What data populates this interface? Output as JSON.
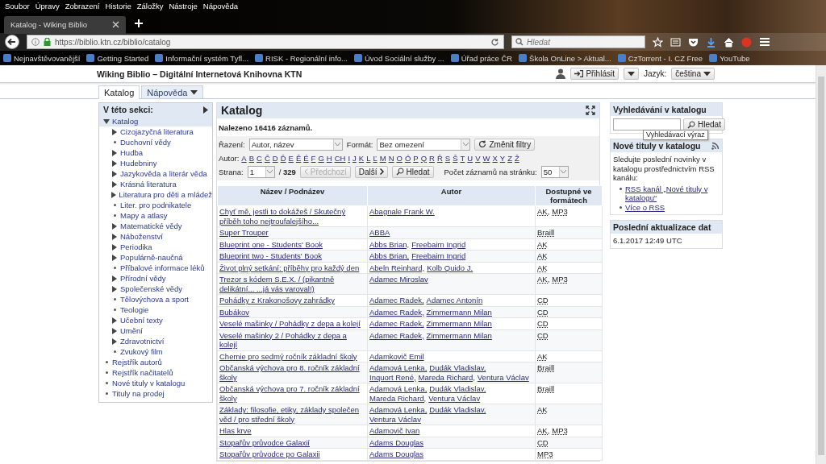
{
  "browser": {
    "menu": [
      "Soubor",
      "Úpravy",
      "Zobrazení",
      "Historie",
      "Záložky",
      "Nástroje",
      "Nápověda"
    ],
    "tab_title": "Katalog - Wiking Biblio",
    "url": "https://biblio.ktn.cz/biblio/catalog",
    "search": {
      "placeholder": "Hledat"
    },
    "bookmarks": [
      "Nejnavštěvovanější",
      "Getting Started",
      "Informační systém Tyfl...",
      "RISK - Regionální info...",
      "Úvod Sociální služby ...",
      "Úřad práce ČR",
      "Škola OnLine > Aktual...",
      "CzTorrent - I. CZ Free",
      "YouTube"
    ]
  },
  "site": {
    "title": "Wiking Biblio – Digitální Internetová Knihovna KTN",
    "login": "Přihlásit",
    "language_label": "Jazyk:",
    "language": "čeština",
    "tabs": [
      {
        "label": "Katalog",
        "selected": true,
        "dropdown": false
      },
      {
        "label": "Nápověda",
        "selected": false,
        "dropdown": true
      }
    ]
  },
  "sidebar": {
    "title": "V této sekci:",
    "items": [
      {
        "label": "Katalog",
        "kind": "branch",
        "expanded": true,
        "selected": true,
        "children": [
          {
            "label": "Cizojazyčná literatura",
            "kind": "branch",
            "expanded": false,
            "selected": false
          },
          {
            "label": "Duchovní vědy",
            "kind": "leaf",
            "selected": false
          },
          {
            "label": "Hudba",
            "kind": "branch",
            "expanded": false,
            "selected": false
          },
          {
            "label": "Hudebniny",
            "kind": "branch",
            "expanded": false,
            "selected": false
          },
          {
            "label": "Jazykověda a literár věda",
            "kind": "branch",
            "expanded": false,
            "selected": false
          },
          {
            "label": "Krásná literatura",
            "kind": "branch",
            "expanded": false,
            "selected": false
          },
          {
            "label": "Literatura pro děti a mládež",
            "kind": "branch",
            "expanded": false,
            "selected": false
          },
          {
            "label": "Liter. pro podnikatele",
            "kind": "leaf",
            "selected": false
          },
          {
            "label": "Mapy a atlasy",
            "kind": "leaf",
            "selected": false
          },
          {
            "label": "Matematické vědy",
            "kind": "branch",
            "expanded": false,
            "selected": false
          },
          {
            "label": "Náboženství",
            "kind": "branch",
            "expanded": false,
            "selected": false
          },
          {
            "label": "Periodika",
            "kind": "branch",
            "expanded": false,
            "selected": false
          },
          {
            "label": "Populárně-naučná",
            "kind": "branch",
            "expanded": false,
            "selected": false
          },
          {
            "label": "Příbalové informace léků",
            "kind": "leaf",
            "selected": false
          },
          {
            "label": "Přírodní vědy",
            "kind": "branch",
            "expanded": false,
            "selected": false
          },
          {
            "label": "Společenské vědy",
            "kind": "branch",
            "expanded": false,
            "selected": false
          },
          {
            "label": "Tělovýchova a sport",
            "kind": "leaf",
            "selected": false
          },
          {
            "label": "Teologie",
            "kind": "leaf",
            "selected": false
          },
          {
            "label": "Učební texty",
            "kind": "branch",
            "expanded": false,
            "selected": false
          },
          {
            "label": "Umění",
            "kind": "branch",
            "expanded": false,
            "selected": false
          },
          {
            "label": "Zdravotnictví",
            "kind": "branch",
            "expanded": false,
            "selected": false
          },
          {
            "label": "Zvukový film",
            "kind": "leaf",
            "selected": false
          }
        ]
      },
      {
        "label": "Rejstřík autorů",
        "kind": "leaf",
        "selected": false
      },
      {
        "label": "Rejstřík načitatelů",
        "kind": "leaf",
        "selected": false
      },
      {
        "label": "Nové tituly v katalogu",
        "kind": "leaf",
        "selected": false
      },
      {
        "label": "Tituly na prodej",
        "kind": "leaf",
        "selected": false
      }
    ]
  },
  "main": {
    "heading": "Katalog",
    "found": "Nalezeno 16416 záznamů.",
    "sort_label": "Řazení:",
    "sort_value": "Autor, název",
    "format_label": "Formát:",
    "format_value": "Bez omezení",
    "change_filters": "Změnit filtry",
    "author_label": "Autor:",
    "letters": [
      "A",
      "B",
      "C",
      "Č",
      "D",
      "Ď",
      "E",
      "Ě",
      "É",
      "F",
      "G",
      "H",
      "CH",
      "I",
      "J",
      "K",
      "L",
      "Ľ",
      "M",
      "N",
      "O",
      "Ó",
      "P",
      "Q",
      "R",
      "Ř",
      "S",
      "Š",
      "T",
      "U",
      "V",
      "W",
      "X",
      "Y",
      "Z",
      "Ž"
    ],
    "page_label": "Strana:",
    "page_value": "1",
    "page_total": "/ **329**",
    "prev": {
      "label": "Předchozí",
      "disabled": true
    },
    "next": {
      "label": "Další",
      "disabled": false
    },
    "search_button": "Hledat",
    "per_page_label": "Počet záznamů na stránku:",
    "per_page_value": "50",
    "table": {
      "columns": [
        "Název / Podnázev",
        "Autor",
        "Dostupné ve formátech"
      ],
      "rows": [
        {
          "title": "Chyť mě, jestli to dokážeš / Skutečný příběh toho nejtroufalejšího...",
          "authors": [
            "Abagnale Frank W."
          ],
          "formats": [
            "AK,",
            "MP3"
          ]
        },
        {
          "title": "Super Trouper",
          "authors": [
            "ABBA"
          ],
          "formats": [
            "Braill"
          ]
        },
        {
          "title": "Blueprint one - Students' Book",
          "authors": [
            "Abbs Brian,",
            "Freebairn Ingrid"
          ],
          "formats": [
            "AK"
          ]
        },
        {
          "title": "Blueprint two - Students' Book",
          "authors": [
            "Abbs Brian,",
            "Freebairn Ingrid"
          ],
          "formats": [
            "AK"
          ]
        },
        {
          "title": "Život plný setkání: příběhy pro každý den",
          "authors": [
            "Abeln Reinhard,",
            "Kolb Quido J."
          ],
          "formats": [
            "AK"
          ]
        },
        {
          "title": "Trezor s kódem S.E.X. / (pikantně delikátní... ...já vás varoval!)",
          "authors": [
            "Adamec Miroslav"
          ],
          "formats": [
            "AK,",
            "MP3"
          ]
        },
        {
          "title": "Pohádky z Krakonošovy zahrádky",
          "authors": [
            "Adamec Radek,",
            "Adamec Antonín"
          ],
          "formats": [
            "CD"
          ]
        },
        {
          "title": "Bubákov",
          "authors": [
            "Adamec Radek,",
            "Zimmermann Milan"
          ],
          "formats": [
            "CD"
          ]
        },
        {
          "title": "Veselé mašinky / Pohádky z depa a kolejí",
          "authors": [
            "Adamec Radek,",
            "Zimmermann Milan"
          ],
          "formats": [
            "CD"
          ]
        },
        {
          "title": "Veselé mašinky 2 / Pohádky z depa a kolejí",
          "authors": [
            "Adamec Radek,",
            "Zimmermann Milan"
          ],
          "formats": [
            "CD"
          ]
        },
        {
          "title": "Chemie pro sedmý ročník základní školy",
          "authors": [
            "Adamkovič Emil"
          ],
          "formats": [
            "AK"
          ]
        },
        {
          "title": "Občanská výchova pro 8. ročník základní školy",
          "authors": [
            "Adamová Lenka,",
            "Dudák Vladislav,",
            "Inquort René,",
            "Mareda Richard,",
            "Ventura Václav"
          ],
          "formats": [
            "Braill"
          ]
        },
        {
          "title": "Občanská výchova pro 7. ročník základní školy",
          "authors": [
            "Adamová Lenka,",
            "Dudák Vladislav,",
            "Mareda Richard,",
            "Ventura Václav"
          ],
          "formats": [
            "Braill"
          ]
        },
        {
          "title": "Základy: filosofie, etiky, základy společen věd / pro střední školy",
          "authors": [
            "Adamová Lenka,",
            "Dudák Vladislav,",
            "Ventura Václav"
          ],
          "formats": [
            "AK"
          ]
        },
        {
          "title": "Hlas krve",
          "authors": [
            "Adamovič Ivan"
          ],
          "formats": [
            "AK,",
            "MP3"
          ]
        },
        {
          "title": "Stopařův průvodce Galaxií",
          "authors": [
            "Adams Douglas"
          ],
          "formats": [
            "CD"
          ]
        },
        {
          "title": "Stopařův průvodce po Galaxii",
          "authors": [
            "Adams Douglas"
          ],
          "formats": [
            "MP3"
          ]
        }
      ]
    }
  },
  "right": {
    "search_title": "Vyhledávání v katalogu",
    "search_button": "Hledat",
    "tooltip": "Vyhledávací výraz",
    "news_title": "Nové tituly v katalogu",
    "news_text": "Sledujte poslední novinky v katalogu prostřednictvím RSS kanálu:",
    "news_links": [
      "RSS kanál „Nové tituly v katalogu“",
      "Více o RSS"
    ],
    "update_title": "Poslední aktualizace dat",
    "update_value": "6.1.2017 12:49 UTC"
  }
}
